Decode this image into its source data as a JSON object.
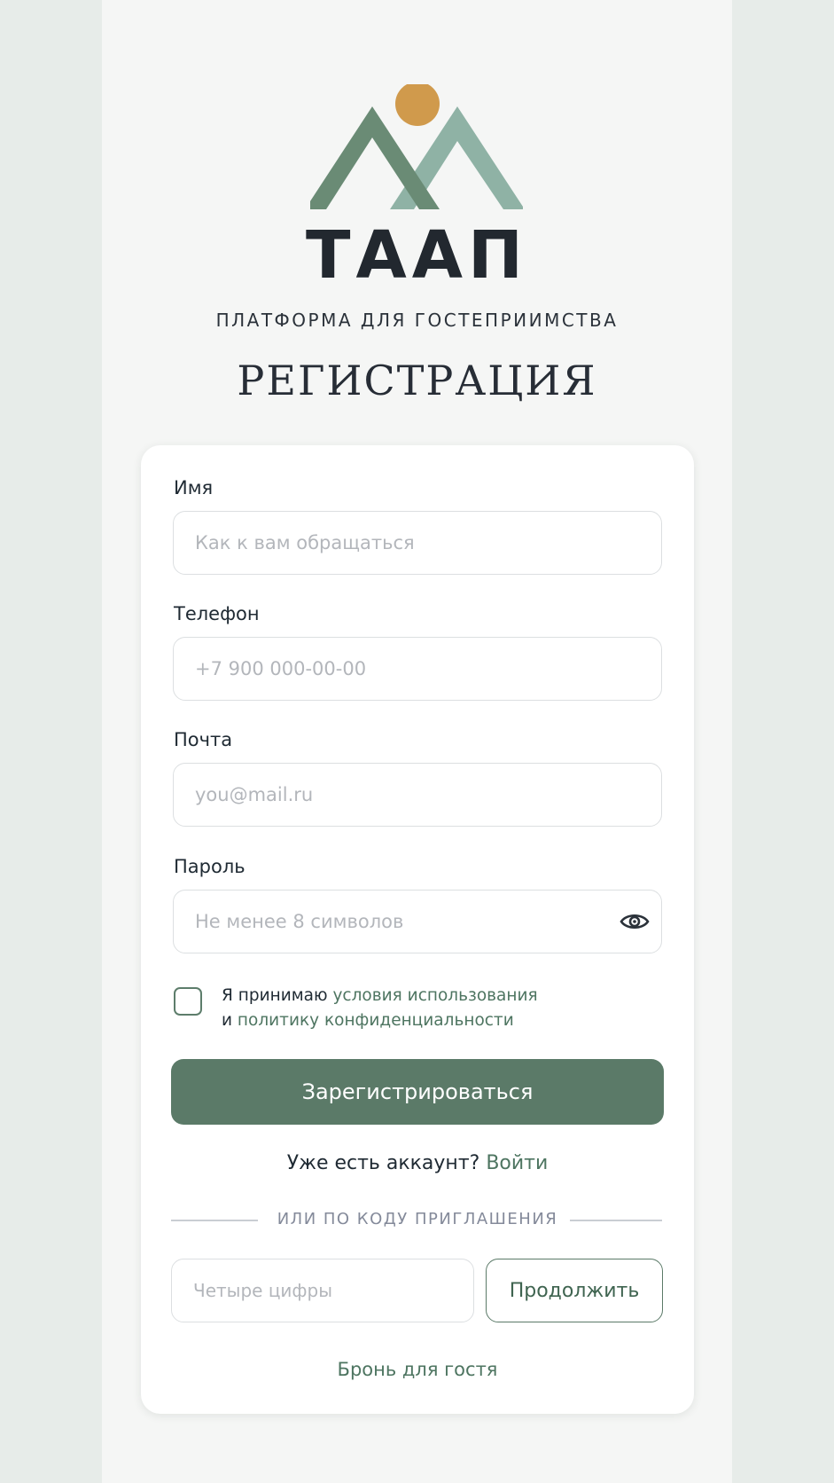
{
  "brand": {
    "name": "ТААП",
    "tagline": "ПЛАТФОРМА ДЛЯ ГОСТЕПРИИМСТВА",
    "colors": {
      "sun": "#d09a4c",
      "mountain_dark": "#6a8b75",
      "mountain_light": "#8fb2a5"
    }
  },
  "page": {
    "title": "РЕГИСТРАЦИЯ"
  },
  "form": {
    "name": {
      "label": "Имя",
      "placeholder": "Как к вам обращаться",
      "value": ""
    },
    "phone": {
      "label": "Телефон",
      "placeholder": "+7 900 000-00-00",
      "value": ""
    },
    "email": {
      "label": "Почта",
      "placeholder": "you@mail.ru",
      "value": ""
    },
    "password": {
      "label": "Пароль",
      "placeholder": "Не менее 8 символов",
      "value": "",
      "toggle_icon": "eye-icon"
    },
    "consent": {
      "checked": false,
      "prefix": "Я принимаю ",
      "terms_link": "условия использования",
      "conjunction": "и ",
      "privacy_link": "политику конфиденциальности"
    },
    "submit_label": "Зарегистрироваться"
  },
  "login": {
    "prompt": "Уже есть аккаунт? ",
    "link": "Войти"
  },
  "invite": {
    "divider": "ИЛИ ПО КОДУ ПРИГЛАШЕНИЯ",
    "placeholder": "Четыре цифры",
    "value": "",
    "button_label": "Продолжить"
  },
  "guest_link": "Бронь для гостя",
  "theme": {
    "accent": "#5b7a68",
    "link": "#4e7561",
    "background": "#e7ece9",
    "panel": "#f5f6f5",
    "card": "#ffffff"
  }
}
